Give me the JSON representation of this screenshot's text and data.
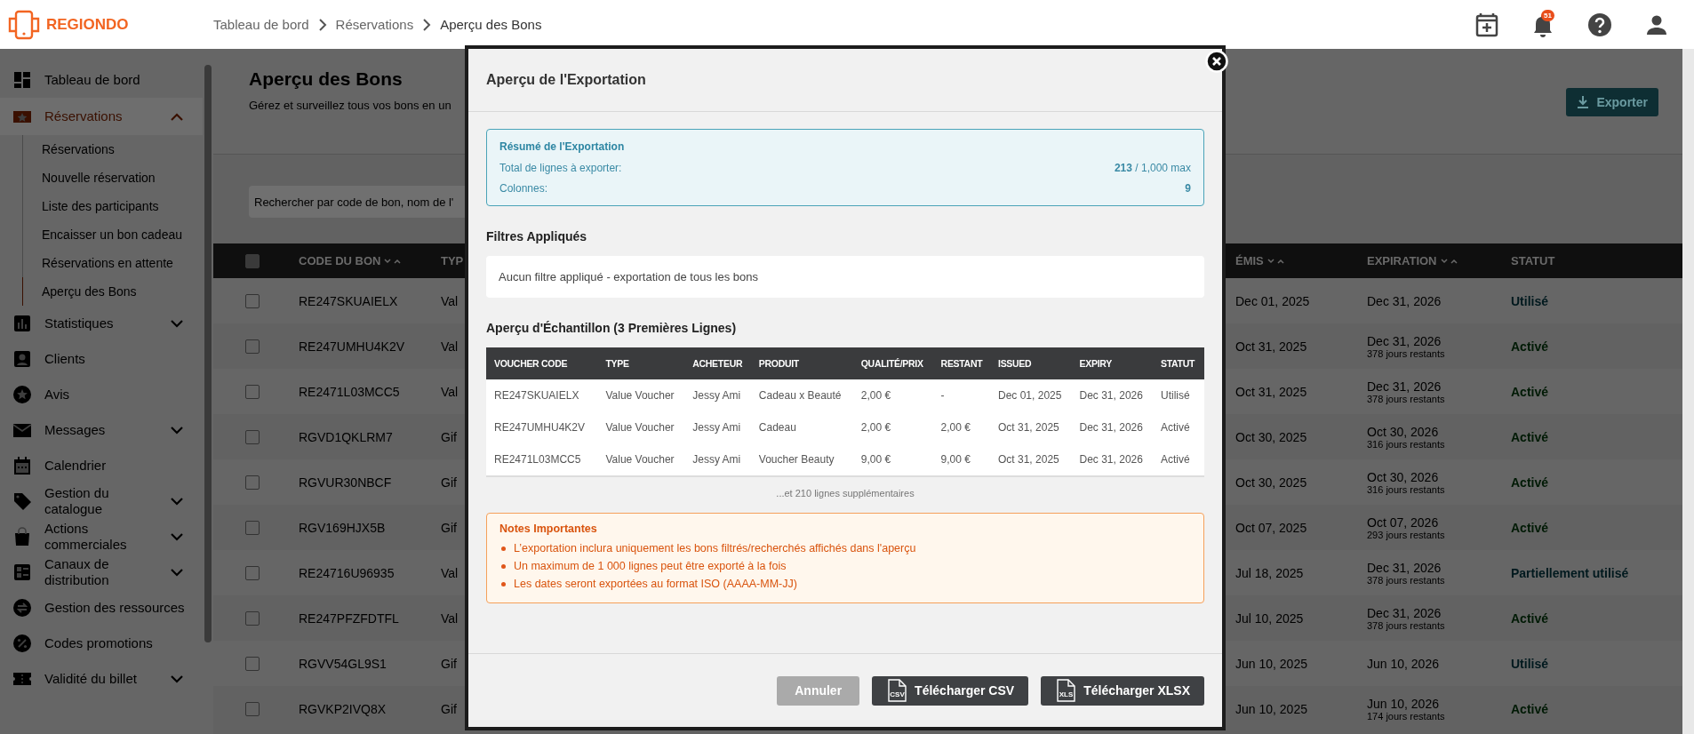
{
  "header": {
    "logo": "REGIONDO",
    "breadcrumb": [
      "Tableau de bord",
      "Réservations",
      "Aperçu des Bons"
    ],
    "notification_count": "51"
  },
  "sidebar": {
    "items": [
      {
        "label": "Tableau de bord",
        "kind": "link",
        "selected": false
      },
      {
        "label": "Réservations",
        "kind": "group",
        "selected": true,
        "expanded": true,
        "children": [
          {
            "label": "Réservations",
            "selected": false
          },
          {
            "label": "Nouvelle réservation",
            "selected": false
          },
          {
            "label": "Liste des participants",
            "selected": false
          },
          {
            "label": "Encaisser un bon cadeau",
            "selected": false
          },
          {
            "label": "Réservations en attente",
            "selected": false
          },
          {
            "label": "Aperçu des Bons",
            "selected": true
          }
        ]
      },
      {
        "label": "Statistiques",
        "kind": "group",
        "selected": false,
        "expanded": false
      },
      {
        "label": "Clients",
        "kind": "link",
        "selected": false
      },
      {
        "label": "Avis",
        "kind": "link",
        "selected": false
      },
      {
        "label": "Messages",
        "kind": "group",
        "selected": false,
        "expanded": false
      },
      {
        "label": "Calendrier",
        "kind": "link",
        "selected": false
      },
      {
        "label": "Gestion du catalogue",
        "kind": "group",
        "selected": false,
        "expanded": false
      },
      {
        "label": "Actions commerciales",
        "kind": "group",
        "selected": false,
        "expanded": false
      },
      {
        "label": "Canaux de distribution",
        "kind": "group",
        "selected": false,
        "expanded": false
      },
      {
        "label": "Gestion des ressources",
        "kind": "link",
        "selected": false
      },
      {
        "label": "Codes promotions",
        "kind": "link",
        "selected": false
      },
      {
        "label": "Validité du billet",
        "kind": "group",
        "selected": false,
        "expanded": false
      }
    ]
  },
  "page": {
    "title": "Aperçu des Bons",
    "subtitle": "Gérez et surveillez tous vos bons en un",
    "export_button": "Exporter",
    "search": {
      "placeholder": "Rechercher par code de bon, nom de l'"
    }
  },
  "table": {
    "select_all": {
      "checked": false
    },
    "columns": [
      {
        "label": "CODE DU BON",
        "sortable": true
      },
      {
        "label": "TYP",
        "sortable": false
      },
      {
        "label": "ÉMIS",
        "sortable": true
      },
      {
        "label": "EXPIRATION",
        "sortable": true
      },
      {
        "label": "STATUT",
        "sortable": false
      }
    ],
    "rows": [
      {
        "checked": false,
        "code": "RE247SKUAIELX",
        "type": "Val",
        "issued": "Dec 01, 2025",
        "expiration": "Dec 31, 2026",
        "status": "Utilisé",
        "color": "#00191e"
      },
      {
        "checked": false,
        "code": "RE247UMHU4K2V",
        "type": "Val",
        "issued": "Oct 31, 2025",
        "expiration": "Dec 31, 2026",
        "remaining": "378 jours restants",
        "status": "Activé",
        "color": "#001a05"
      },
      {
        "checked": false,
        "code": "RE2471L03MCC5",
        "type": "Val",
        "issued": "Oct 31, 2025",
        "expiration": "Dec 31, 2026",
        "remaining": "378 jours restants",
        "status": "Activé",
        "color": "#001a05"
      },
      {
        "checked": false,
        "code": "RGVD1QKLRM7",
        "type": "Gif",
        "issued": "Oct 30, 2025",
        "expiration": "Oct 30, 2026",
        "remaining": "316 jours restants",
        "status": "Activé",
        "color": "#001a05"
      },
      {
        "checked": false,
        "code": "RGVUR30NBCF",
        "type": "Gif",
        "issued": "Oct 30, 2025",
        "expiration": "Oct 30, 2026",
        "remaining": "316 jours restants",
        "status": "Activé",
        "color": "#001a05"
      },
      {
        "checked": false,
        "code": "RGV169HJX5B",
        "type": "Gif",
        "issued": "Oct 07, 2025",
        "expiration": "Oct 07, 2026",
        "remaining": "293 jours restants",
        "status": "Activé",
        "color": "#001a05"
      },
      {
        "checked": false,
        "code": "RE24716U96935",
        "type": "Val",
        "issued": "Jul 18, 2025",
        "expiration": "Dec 31, 2026",
        "remaining": "378 jours restants",
        "status": "Partiellement utilisé",
        "color": "#00191e"
      },
      {
        "checked": false,
        "code": "RE247PFZFDTFL",
        "type": "Val",
        "issued": "Jul 10, 2025",
        "expiration": "Dec 31, 2026",
        "remaining": "378 jours restants",
        "status": "Activé",
        "color": "#001a05"
      },
      {
        "checked": false,
        "code": "RGVV54GL9S1",
        "type": "Gif",
        "issued": "Jun 10, 2025",
        "expiration": "Jun 10, 2026",
        "status": "Utilisé",
        "color": "#00191e"
      },
      {
        "checked": false,
        "code": "RGVKP2IVQ8X",
        "type": "Gif",
        "issued": "Jun 10, 2025",
        "expiration": "Jun 10, 2026",
        "remaining": "174 jours restants",
        "status": "Activé",
        "color": "#001a05"
      }
    ]
  },
  "modal": {
    "title": "Aperçu de l'Exportation",
    "summary": {
      "title": "Résumé de l'Exportation",
      "lines": [
        {
          "label": "Total de lignes à exporter:",
          "value": "**213** / 1,000 max"
        },
        {
          "label": "Colonnes:",
          "value": "**9**"
        }
      ]
    },
    "filters": {
      "title": "Filtres Appliqués",
      "text": "Aucun filtre appliqué - exportation de tous les bons"
    },
    "sample": {
      "title": "Aperçu d'Échantillon (3 Premières Lignes)",
      "columns": [
        "VOUCHER CODE",
        "TYPE",
        "ACHETEUR",
        "PRODUIT",
        "QUALITÉ/PRIX",
        "RESTANT",
        "ISSUED",
        "EXPIRY",
        "STATUT"
      ],
      "rows": [
        [
          "RE247SKUAIELX",
          "Value Voucher",
          "Jessy Ami",
          "Cadeau x Beauté",
          "2,00 €",
          "-",
          "Dec 01, 2025",
          "Dec 31, 2026",
          "Utilisé"
        ],
        [
          "RE247UMHU4K2V",
          "Value Voucher",
          "Jessy Ami",
          "Cadeau",
          "2,00 €",
          "2,00 €",
          "Oct 31, 2025",
          "Dec 31, 2026",
          "Activé"
        ],
        [
          "RE2471L03MCC5",
          "Value Voucher",
          "Jessy Ami",
          "Voucher Beauty",
          "9,00 €",
          "9,00 €",
          "Oct 31, 2025",
          "Dec 31, 2026",
          "Activé"
        ]
      ],
      "more": "...et 210 lignes supplémentaires"
    },
    "notes": {
      "title": "Notes Importantes",
      "items": [
        "L’exportation inclura uniquement les bons filtrés/recherchés affichés dans l'aperçu",
        "Un maximum de 1 000 lignes peut être exporté à la fois",
        "Les dates seront exportées au format ISO (AAAA-MM-JJ)"
      ]
    },
    "buttons": [
      {
        "label": "Annuler",
        "kind": "cancel"
      },
      {
        "label": "Télécharger CSV",
        "kind": "download",
        "icon_text": "CSV"
      },
      {
        "label": "Télécharger XLSX",
        "kind": "download",
        "icon_text": "XLS"
      }
    ]
  }
}
